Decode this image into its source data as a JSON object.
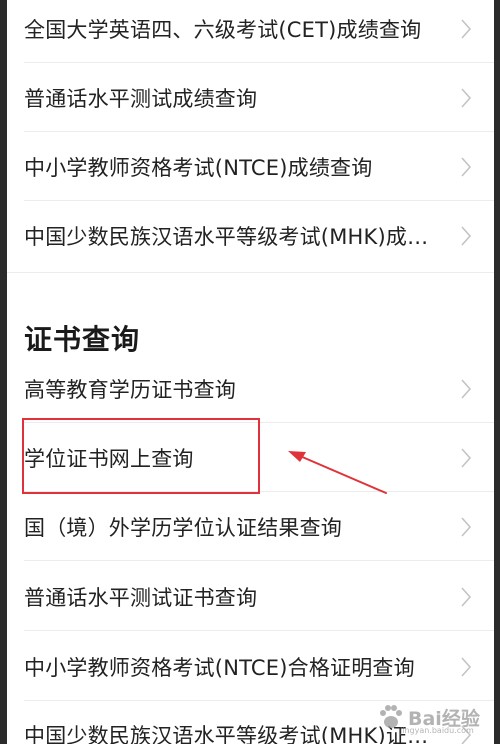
{
  "exam_scores": {
    "items": [
      {
        "label": "全国大学英语四、六级考试(CET)成绩查询"
      },
      {
        "label": "普通话水平测试成绩查询"
      },
      {
        "label": "中小学教师资格考试(NTCE)成绩查询"
      },
      {
        "label": "中国少数民族汉语水平等级考试(MHK)成…"
      }
    ]
  },
  "certificates": {
    "title": "证书查询",
    "items": [
      {
        "label": "高等教育学历证书查询"
      },
      {
        "label": "学位证书网上查询"
      },
      {
        "label": "国（境）外学历学位认证结果查询"
      },
      {
        "label": "普通话水平测试证书查询"
      },
      {
        "label": "中小学教师资格考试(NTCE)合格证明查询"
      },
      {
        "label": "中国少数民族汉语水平等级考试(MHK)证…"
      }
    ]
  },
  "annotation": {
    "highlighted_item": "学位证书网上查询",
    "color": "#e0323a"
  },
  "watermark": {
    "brand": "Bai经验",
    "url": "jingyan.baidu.com"
  },
  "icons": {
    "row_chevron": "chevron-right-icon"
  }
}
